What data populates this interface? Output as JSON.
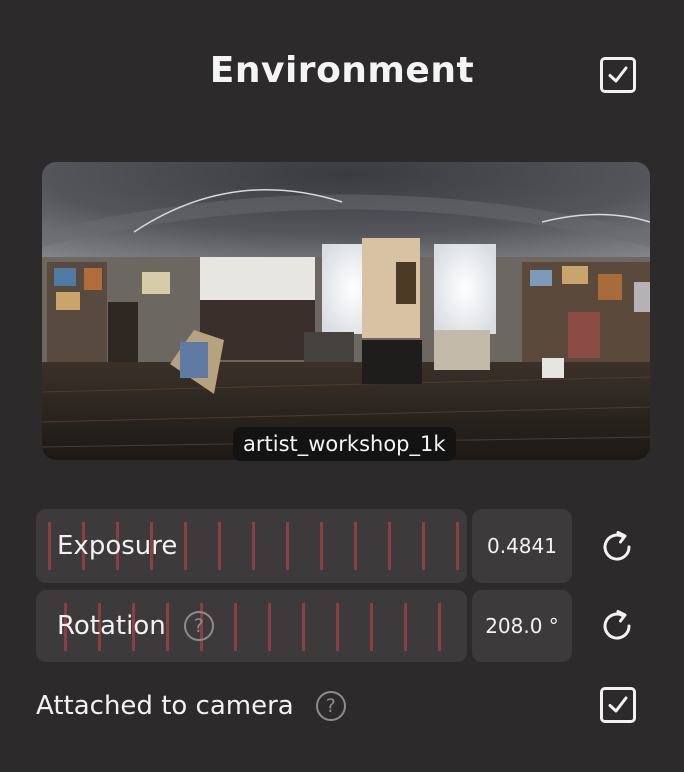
{
  "panel": {
    "title": "Environment",
    "enabled": true
  },
  "environment_map": {
    "name": "artist_workshop_1k"
  },
  "exposure": {
    "label": "Exposure",
    "value": "0.4841"
  },
  "rotation": {
    "label": "Rotation",
    "value": "208.0 °",
    "help": "?"
  },
  "attached_to_camera": {
    "label": "Attached to camera",
    "help": "?",
    "checked": true
  },
  "icons": {
    "enabled": "checkbox-checked-icon",
    "reset": "reset-icon",
    "help": "help-circle-icon"
  },
  "colors": {
    "background": "#2c2a2b",
    "control_background": "#3c3a3b",
    "slider_tick": "#8a3f42",
    "text": "#f2f2f2"
  }
}
